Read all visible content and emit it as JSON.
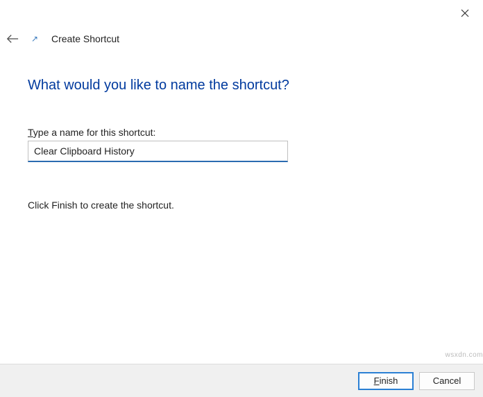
{
  "close_icon_name": "close-icon",
  "header": {
    "title": "Create Shortcut"
  },
  "content": {
    "heading": "What would you like to name the shortcut?",
    "input_label_prefix": "T",
    "input_label_rest": "ype a name for this shortcut:",
    "input_value": "Clear Clipboard History",
    "instruction": "Click Finish to create the shortcut."
  },
  "footer": {
    "finish_prefix": "F",
    "finish_rest": "inish",
    "cancel_rest": "Cancel"
  },
  "watermark": "wsxdn.com"
}
